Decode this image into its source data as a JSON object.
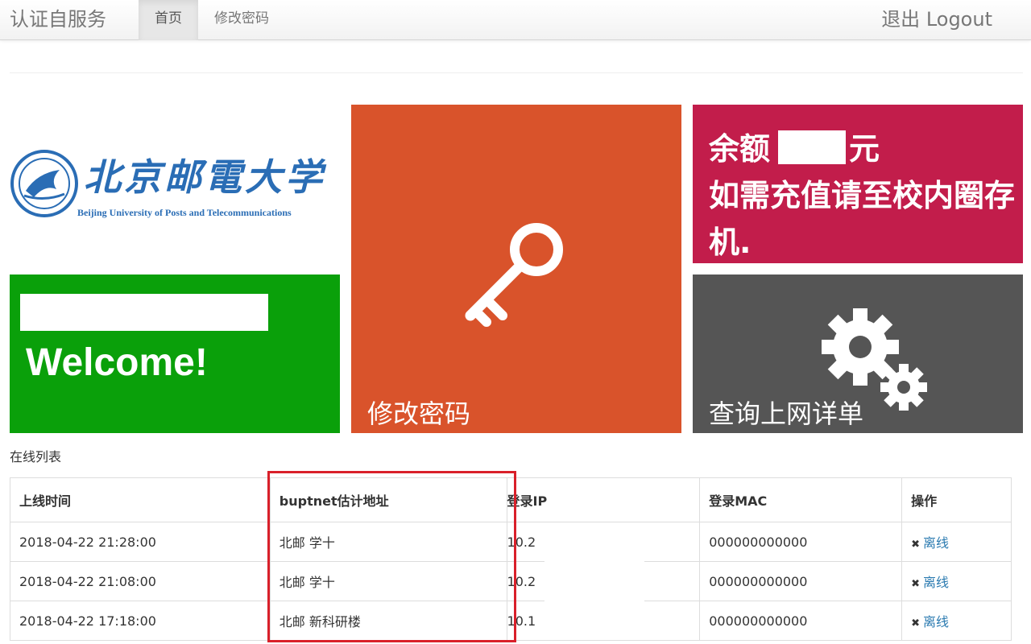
{
  "navbar": {
    "brand": "认证自服务",
    "tabs": [
      {
        "label": "首页",
        "active": true
      },
      {
        "label": "修改密码",
        "active": false
      }
    ],
    "logout": "退出 Logout"
  },
  "logo": {
    "name_cn": "北京邮電大学",
    "name_en": "Beijing University of Posts and Telecommunications"
  },
  "tiles": {
    "welcome": {
      "text": "Welcome!",
      "color": "#0aa00a"
    },
    "password": {
      "label": "修改密码",
      "icon": "key-icon",
      "color": "#d9532b"
    },
    "balance": {
      "prefix": "余额",
      "suffix": "元",
      "note": "如需充值请至校内圈存机.",
      "color": "#c21d4b"
    },
    "query": {
      "label": "查询上网详单",
      "icon": "gears-icon",
      "color": "#555555"
    }
  },
  "online_list": {
    "caption": "在线列表",
    "headers": [
      "上线时间",
      "buptnet估计地址",
      "登录IP",
      "登录MAC",
      "操作"
    ],
    "rows": [
      {
        "time": "2018-04-22 21:28:00",
        "location": "北邮 学十",
        "ip": "10.2",
        "mac": "000000000000",
        "action": "离线"
      },
      {
        "time": "2018-04-22 21:08:00",
        "location": "北邮 学十",
        "ip": "10.2",
        "mac": "000000000000",
        "action": "离线"
      },
      {
        "time": "2018-04-22 17:18:00",
        "location": "北邮 新科研楼",
        "ip": "10.1",
        "mac": "000000000000",
        "action": "离线"
      }
    ]
  },
  "colors": {
    "highlight": "#d9202a",
    "link": "#2a7ab0"
  }
}
